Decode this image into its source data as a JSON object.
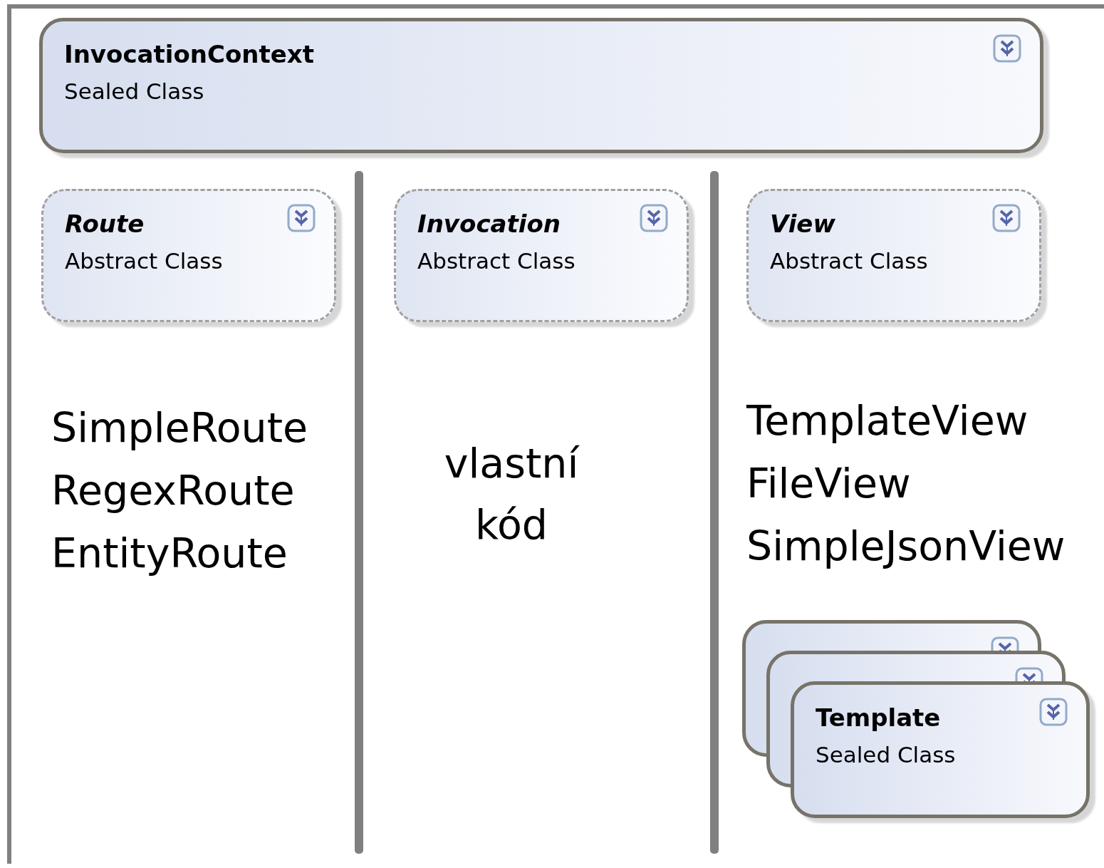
{
  "diagram": {
    "top_class": {
      "kind": "sealed",
      "name": "InvocationContext",
      "type": "Sealed Class"
    },
    "columns": [
      {
        "class": {
          "kind": "abstract",
          "name": "Route",
          "type": "Abstract Class"
        },
        "notes": [
          "SimpleRoute",
          "RegexRoute",
          "EntityRoute"
        ]
      },
      {
        "class": {
          "kind": "abstract",
          "name": "Invocation",
          "type": "Abstract Class"
        },
        "notes": [
          "vlastní",
          "kód"
        ]
      },
      {
        "class": {
          "kind": "abstract",
          "name": "View",
          "type": "Abstract Class"
        },
        "notes": [
          "TemplateView",
          "FileView",
          "SimpleJsonView"
        ],
        "stack": [
          {
            "kind": "covered"
          },
          {
            "kind": "covered"
          },
          {
            "kind": "sealed",
            "name": "Template",
            "type": "Sealed Class"
          }
        ]
      }
    ]
  }
}
